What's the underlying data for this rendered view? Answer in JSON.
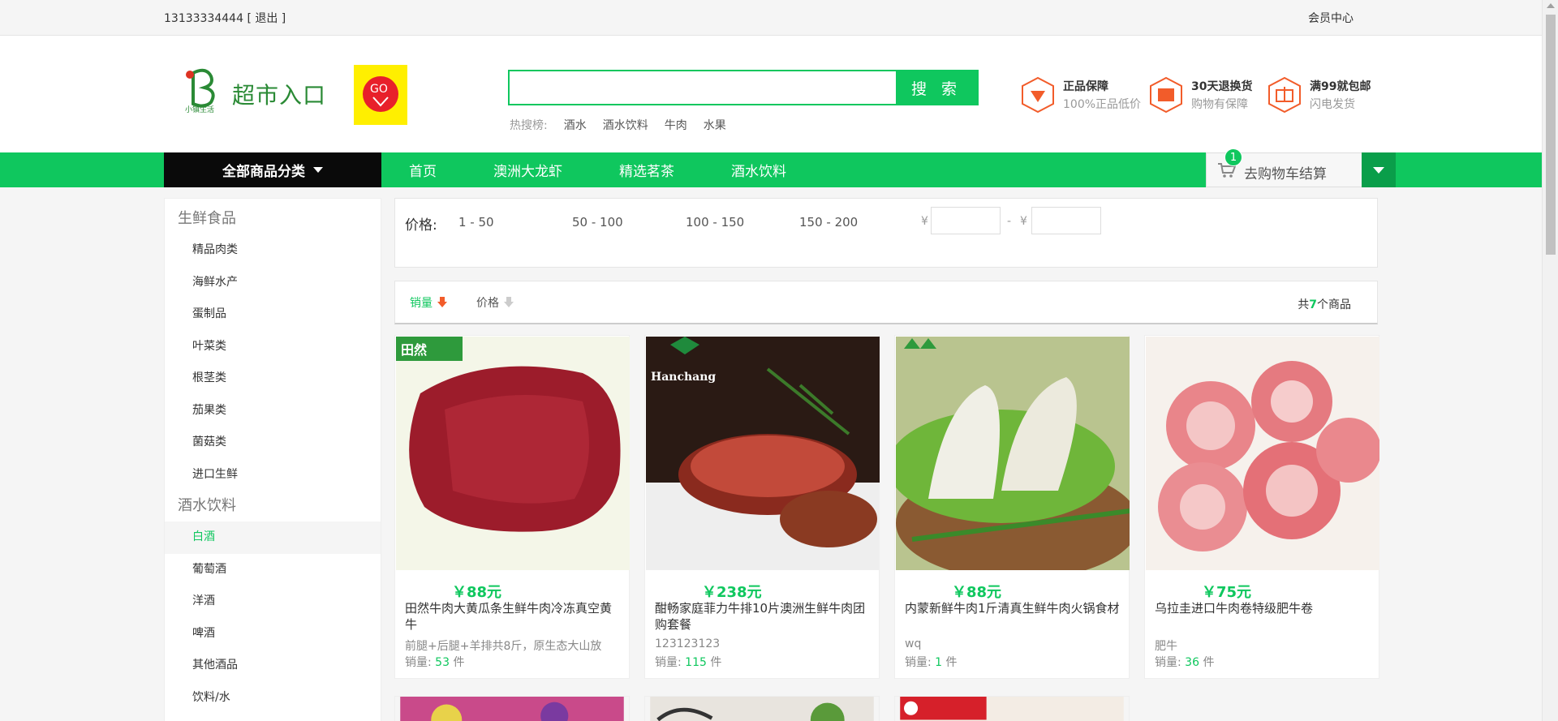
{
  "topbar": {
    "phone": "13133334444",
    "logout": "[ 退出 ]",
    "member_center": "会员中心"
  },
  "logo": {
    "brand_text": "超市入口",
    "badge": "GO",
    "sub": "小镇生活"
  },
  "search": {
    "placeholder": "",
    "button": "搜 索",
    "hot_label": "热搜榜:",
    "hot_terms": [
      "酒水",
      "酒水饮料",
      "牛肉",
      "水果"
    ]
  },
  "promises": [
    {
      "title": "正品保障",
      "sub": "100%正品低价",
      "icon": "diamond-icon"
    },
    {
      "title": "30天退换货",
      "sub": "购物有保障",
      "icon": "box-icon"
    },
    {
      "title": "满99就包邮",
      "sub": "闪电发货",
      "icon": "gift-icon"
    }
  ],
  "nav": {
    "all_categories": "全部商品分类",
    "items": [
      "首页",
      "澳洲大龙虾",
      "精选茗茶",
      "酒水饮料"
    ],
    "cart_label": "去购物车结算",
    "cart_count": "1"
  },
  "sidebar": {
    "group1": "生鲜食品",
    "group1_items": [
      "精品肉类",
      "海鲜水产",
      "蛋制品",
      "叶菜类",
      "根茎类",
      "茄果类",
      "菌菇类",
      "进口生鲜"
    ],
    "group2": "酒水饮料",
    "group2_items": [
      "白酒",
      "葡萄酒",
      "洋酒",
      "啤酒",
      "其他酒品",
      "饮料/水"
    ]
  },
  "filter": {
    "label": "价格:",
    "ranges": [
      "1 - 50",
      "50 - 100",
      "100 - 150",
      "150 - 200"
    ],
    "currency": "¥",
    "dash": "-"
  },
  "sort": {
    "sales": "销量",
    "price": "价格",
    "total_prefix": "共",
    "total_count": "7",
    "total_suffix": "个商品"
  },
  "products": [
    {
      "price": "￥88元",
      "name": "田然牛肉大黄瓜条生鲜牛肉冷冻真空黄牛",
      "desc": "前腿+后腿+羊排共8斤，原生态大山放",
      "sales_label": "销量:",
      "sales": "53",
      "unit": "件",
      "tag": "田然"
    },
    {
      "price": "￥238元",
      "name": "酣畅家庭菲力牛排10片澳洲生鲜牛肉团购套餐",
      "desc": "123123123",
      "sales_label": "销量:",
      "sales": "115",
      "unit": "件",
      "tag": "Hanchang"
    },
    {
      "price": "￥88元",
      "name": "内蒙新鲜牛肉1斤清真生鲜牛肉火锅食材",
      "desc": "wq",
      "sales_label": "销量:",
      "sales": "1",
      "unit": "件",
      "tag": ""
    },
    {
      "price": "￥75元",
      "name": "乌拉圭进口牛肉卷特级肥牛卷",
      "desc": "肥牛",
      "sales_label": "销量:",
      "sales": "36",
      "unit": "件",
      "tag": ""
    }
  ],
  "colors": {
    "brand_green": "#0fc75e",
    "dark": "#0a0a0a"
  }
}
